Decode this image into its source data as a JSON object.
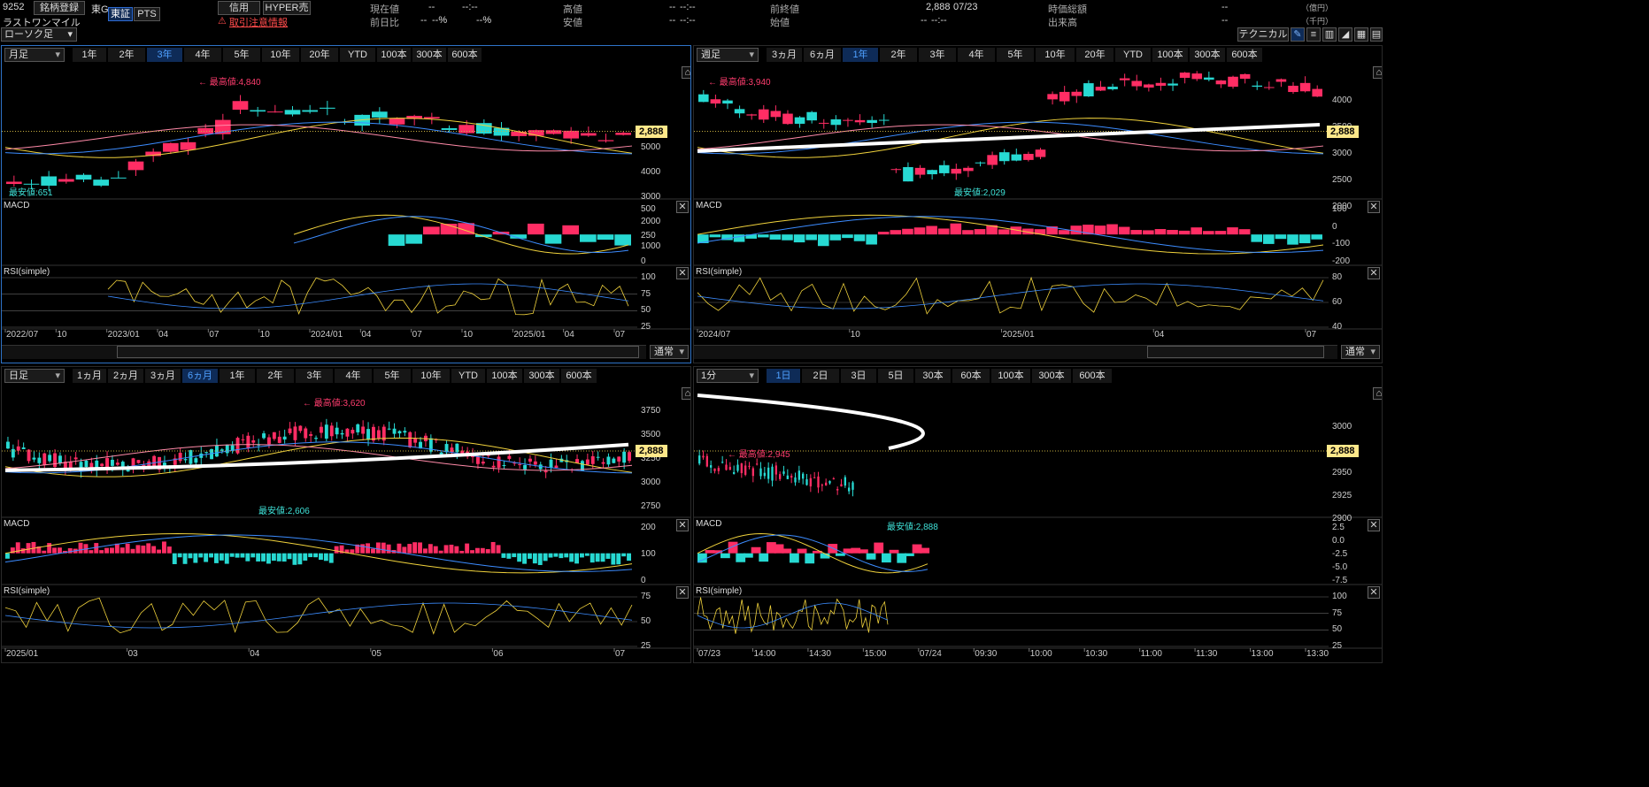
{
  "header": {
    "code": "9252",
    "reg_button": "銘柄登録",
    "market": "東G",
    "tab_tosho": "東証",
    "tab_pts": "PTS",
    "name": "ラストワンマイル",
    "credit_button": "信用",
    "hyper_button": "HYPER売",
    "warning": "取引注意情報",
    "chart_type": "ローソク足",
    "current_label": "現在値",
    "current_value": "--",
    "current_time": "--:--",
    "change_label": "前日比",
    "change_value": "--",
    "change_pct": "--%",
    "change_pct2": "--%",
    "high_label": "高値",
    "high_value": "--",
    "high_time": "--:--",
    "low_label": "安値",
    "low_value": "--",
    "low_time": "--:--",
    "prev_close_label": "前終値",
    "prev_close_value": "2,888",
    "prev_close_date": "07/23",
    "open_label": "始値",
    "open_value": "--",
    "open_time": "--:--",
    "market_cap_label": "時価総額",
    "market_cap_value": "--",
    "market_cap_unit": "（億円）",
    "volume_label": "出来高",
    "volume_value": "--",
    "volume_unit": "（千円）",
    "technical_button": "テクニカル"
  },
  "panels": [
    {
      "period": "月足",
      "buttons": [
        "1年",
        "2年",
        "3年",
        "4年",
        "5年",
        "10年",
        "20年",
        "YTD",
        "100本",
        "300本",
        "600本"
      ],
      "active": "3年",
      "price_axis": [
        "5000",
        "4000",
        "3000",
        "2000",
        "1000"
      ],
      "macd_axis": [
        "500",
        "250",
        "0"
      ],
      "rsi_axis": [
        "100",
        "75",
        "50",
        "25"
      ],
      "x_axis": [
        "2022/07",
        "10",
        "2023/01",
        "04",
        "07",
        "10",
        "2024/01",
        "04",
        "07",
        "10",
        "2025/01",
        "04",
        "07"
      ],
      "high_label": "最高値:4,840",
      "low_label": "最安値:651",
      "price": "2,888",
      "macd": "MACD",
      "rsi": "RSI(simple)",
      "mode": "通常"
    },
    {
      "period": "週足",
      "buttons": [
        "3ヵ月",
        "6ヵ月",
        "1年",
        "2年",
        "3年",
        "4年",
        "5年",
        "10年",
        "20年",
        "YTD",
        "100本",
        "300本",
        "600本"
      ],
      "active": "1年",
      "price_axis": [
        "4000",
        "3500",
        "3000",
        "2500",
        "2000"
      ],
      "macd_axis": [
        "100",
        "0",
        "-100",
        "-200"
      ],
      "rsi_axis": [
        "80",
        "60",
        "40"
      ],
      "x_axis": [
        "2024/07",
        "10",
        "2025/01",
        "04",
        "07"
      ],
      "high_label": "最高値:3,940",
      "low_label": "最安値:2,029",
      "price": "2,888",
      "macd": "MACD",
      "rsi": "RSI(simple)",
      "mode": "通常"
    },
    {
      "period": "日足",
      "buttons": [
        "1ヵ月",
        "2ヵ月",
        "3ヵ月",
        "6ヵ月",
        "1年",
        "2年",
        "3年",
        "4年",
        "5年",
        "10年",
        "YTD",
        "100本",
        "300本",
        "600本"
      ],
      "active": "6ヵ月",
      "price_axis": [
        "3750",
        "3500",
        "3250",
        "3000",
        "2750"
      ],
      "macd_axis": [
        "200",
        "100",
        "0"
      ],
      "rsi_axis": [
        "75",
        "50",
        "25"
      ],
      "x_axis": [
        "2025/01",
        "03",
        "04",
        "05",
        "06",
        "07"
      ],
      "high_label": "最高値:3,620",
      "low_label": "最安値:2,606",
      "price": "2,888",
      "macd": "MACD",
      "rsi": "RSI(simple)"
    },
    {
      "period": "1分",
      "buttons": [
        "1日",
        "2日",
        "3日",
        "5日",
        "30本",
        "60本",
        "100本",
        "300本",
        "600本"
      ],
      "active": "1日",
      "price_axis": [
        "3000",
        "2975",
        "2950",
        "2925",
        "2900"
      ],
      "macd_axis": [
        "2.5",
        "0.0",
        "-2.5",
        "-5.0",
        "-7.5"
      ],
      "rsi_axis": [
        "100",
        "75",
        "50",
        "25"
      ],
      "x_axis": [
        "07/23",
        "14:00",
        "14:30",
        "15:00",
        "07/24",
        "09:30",
        "10:00",
        "10:30",
        "11:00",
        "11:30",
        "13:00",
        "13:30"
      ],
      "high_label": "最高値:2,945",
      "low_label": "最安値:2,888",
      "price": "2,888",
      "macd": "MACD",
      "rsi": "RSI(simple)"
    }
  ]
}
